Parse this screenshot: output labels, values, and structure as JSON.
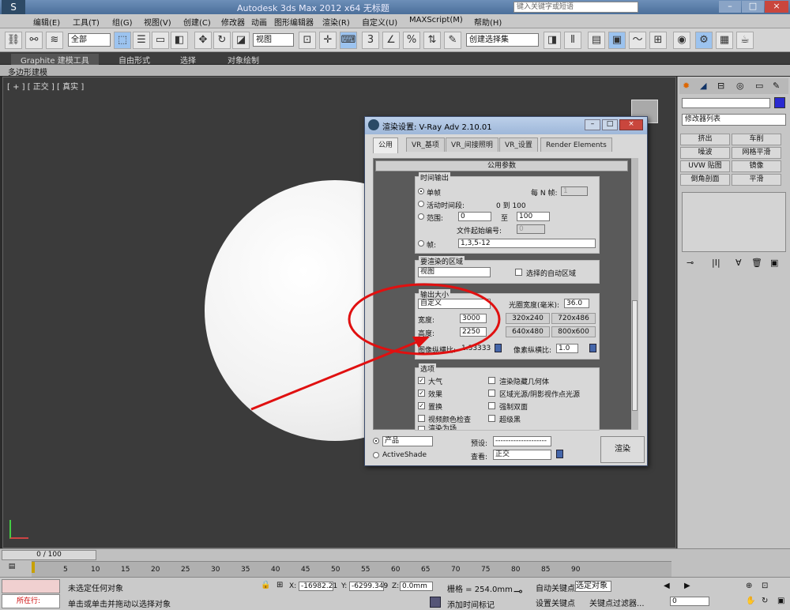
{
  "titlebar": {
    "app_title": "Autodesk 3ds Max  2012 x64     无标题",
    "search_placeholder": "键入关键字或短语"
  },
  "menu": [
    "编辑(E)",
    "工具(T)",
    "组(G)",
    "视图(V)",
    "创建(C)",
    "修改器",
    "动画",
    "图形编辑器",
    "渲染(R)",
    "自定义(U)",
    "MAXScript(M)",
    "帮助(H)"
  ],
  "toolbar": {
    "selection_filter": "全部",
    "ref_coord": "视图",
    "named_selection": "创建选择集"
  },
  "ribbon": {
    "tabs": [
      "Graphite 建模工具",
      "自由形式",
      "选择",
      "对象绘制"
    ],
    "sub_label": "多边形建模"
  },
  "viewport": {
    "label": "[ + ] [ 正交 ] [ 真实 ]"
  },
  "command_panel": {
    "modifier_list": "修改器列表",
    "buttons": [
      "挤出",
      "车削",
      "噪波",
      "网格平滑",
      "UVW 贴图",
      "镜像",
      "倒角剖面",
      "平滑"
    ]
  },
  "dialog": {
    "title": "渲染设置: V-Ray Adv 2.10.01",
    "tabs": [
      "公用",
      "VR_基项",
      "VR_间接照明",
      "VR_设置",
      "Render Elements"
    ],
    "rollout": "公用参数",
    "time_output": {
      "label": "时间输出",
      "single": "单帧",
      "every_n": "每 N 帧:",
      "every_n_value": "1",
      "active_segment": "活动时间段:",
      "active_range": "0 到 100",
      "range": "范围:",
      "range_from": "0",
      "range_to_label": "至",
      "range_to": "100",
      "file_start": "文件起始编号:",
      "file_start_value": "0",
      "frames": "帧:",
      "frames_value": "1,3,5-12"
    },
    "area": {
      "label": "要渲染的区域",
      "value": "视图",
      "auto_region": "选择的自动区域"
    },
    "output_size": {
      "label": "输出大小",
      "preset": "自定义",
      "aperture_label": "光圈宽度(毫米):",
      "aperture": "36.0",
      "width_label": "宽度:",
      "width": "3000",
      "height_label": "高度:",
      "height": "2250",
      "presets": [
        "320x240",
        "720x486",
        "640x480",
        "800x600"
      ],
      "aspect_label": "图像纵横比:",
      "aspect": "1.33333",
      "pixel_aspect_label": "像素纵横比:",
      "pixel_aspect": "1.0"
    },
    "options": {
      "label": "选项",
      "items": [
        {
          "label": "大气",
          "checked": true
        },
        {
          "label": "渲染隐藏几何体",
          "checked": false
        },
        {
          "label": "效果",
          "checked": true
        },
        {
          "label": "区域光源/阴影视作点光源",
          "checked": false
        },
        {
          "label": "置换",
          "checked": true
        },
        {
          "label": "强制双面",
          "checked": false
        },
        {
          "label": "视频颜色检查",
          "checked": false
        },
        {
          "label": "超级黑",
          "checked": false
        }
      ],
      "partial": "渲染为场"
    },
    "bottom": {
      "mode": "产品",
      "activeshade": "ActiveShade",
      "preset_label": "预设:",
      "preset_value": "--------------------",
      "view_label": "查看:",
      "view_value": "正交",
      "render": "渲染"
    }
  },
  "timeline": {
    "frame": "0 / 100",
    "ticks": [
      "0",
      "5",
      "10",
      "15",
      "20",
      "25",
      "30",
      "35",
      "40",
      "45",
      "50",
      "55",
      "60",
      "65",
      "70",
      "75",
      "80",
      "85",
      "90"
    ]
  },
  "status": {
    "script_label": "所在行:",
    "selection": "未选定任何对象",
    "prompt": "单击或单击并拖动以选择对象",
    "x_label": "X:",
    "x": "-16982.21",
    "y_label": "Y:",
    "y": "-6299.349",
    "z_label": "Z:",
    "z": "0.0mm",
    "grid": "栅格 = 254.0mm",
    "add_time_tag": "添加时间标记",
    "auto_key": "自动关键点",
    "selected_obj": "选定对象",
    "set_key": "设置关键点",
    "key_filter": "关键点过滤器...",
    "frame_field": "0"
  },
  "colors": {
    "annotation": "#e01010",
    "viewport_bg": "#3b3b3b"
  }
}
